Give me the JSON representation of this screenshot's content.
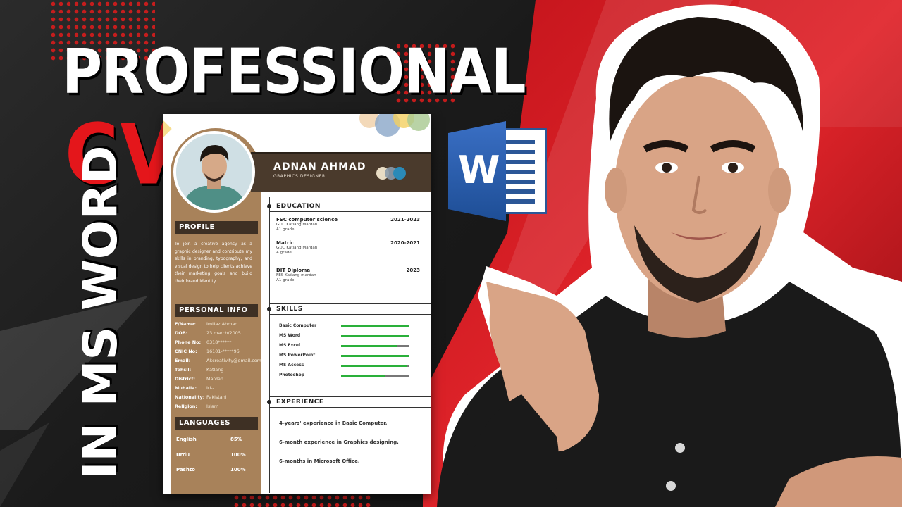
{
  "thumbnail": {
    "headline": "PROFESSIONAL",
    "headline_accent": "CV",
    "headline_vertical": "IN MS WORD",
    "colors": {
      "accent_red": "#e4161b",
      "sidebar_brown": "#a8825a",
      "word_blue": "#2b5797"
    },
    "word_icon": {
      "icon": "ms-word-icon",
      "letter": "W"
    }
  },
  "cv": {
    "name": "ADNAN AHMAD",
    "role": "GRAPHICS DESIGNER",
    "profile": {
      "heading": "PROFILE",
      "text": "To join a creative agency as a graphic designer and contribute my skills in branding, typography, and visual design to help clients achieve their marketing goals and build their brand identity."
    },
    "personal_info": {
      "heading": "PERSONAL INFO",
      "rows": [
        {
          "k": "F/Name:",
          "v": "Imtiaz Ahmad"
        },
        {
          "k": "DOB:",
          "v": "23 march/2005"
        },
        {
          "k": "Phone No:",
          "v": "0318******"
        },
        {
          "k": "CNIC No:",
          "v": "16101-*****96"
        },
        {
          "k": "Email:",
          "v": "Akcreativity@gmail.com"
        },
        {
          "k": "Tehsil:",
          "v": "Katlang"
        },
        {
          "k": "District:",
          "v": "Mardan"
        },
        {
          "k": "Muhalla:",
          "v": "Iri--"
        },
        {
          "k": "Nationality:",
          "v": "Pakistani"
        },
        {
          "k": "Religion:",
          "v": "Islam"
        }
      ]
    },
    "languages": {
      "heading": "LANGUAGES",
      "rows": [
        {
          "k": "English",
          "v": "85%"
        },
        {
          "k": "Urdu",
          "v": "100%"
        },
        {
          "k": "Pashto",
          "v": "100%"
        }
      ]
    },
    "education": {
      "heading": "EDUCATION",
      "items": [
        {
          "title": "FSC computer science",
          "year": "2021-2023",
          "school": "GDC Katlang Mardan",
          "grade": "A1 grade"
        },
        {
          "title": "Matric",
          "year": "2020-2021",
          "school": "GDC Katlang Mardan",
          "grade": "A grade"
        },
        {
          "title": "DIT Diploma",
          "year": "2023",
          "school": "FES Katlang mardan",
          "grade": "A1 grade"
        }
      ]
    },
    "skills": {
      "heading": "SKILLS",
      "items": [
        {
          "name": "Basic Computer",
          "level": 1.0
        },
        {
          "name": "MS Word",
          "level": 1.0
        },
        {
          "name": "MS Excel",
          "level": 0.82
        },
        {
          "name": "MS PowerPoint",
          "level": 1.0
        },
        {
          "name": "MS Access",
          "level": 0.97
        },
        {
          "name": "Photoshop",
          "level": 0.66
        }
      ]
    },
    "experience": {
      "heading": "EXPERIENCE",
      "items": [
        "4-years' experience in Basic Computer.",
        "6-month experience in Graphics designing.",
        "6-months in Microsoft Office."
      ]
    }
  }
}
